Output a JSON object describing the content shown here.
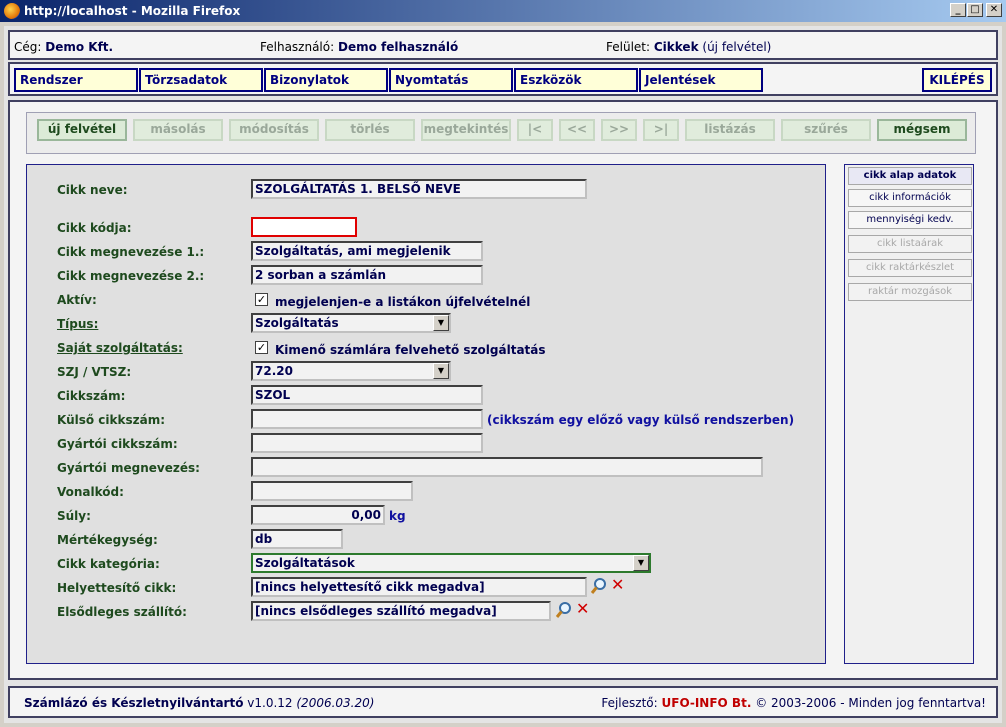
{
  "window": {
    "title": "http://localhost - Mozilla Firefox",
    "min": "_",
    "max": "□",
    "close": "✕"
  },
  "info": {
    "company_label": "Cég:",
    "company": "Demo Kft.",
    "user_label": "Felhasználó:",
    "user": "Demo felhasználó",
    "surface_label": "Felület:",
    "surface": "Cikkek",
    "surface_mode": "(új felvétel)"
  },
  "menu": [
    "Rendszer",
    "Törzsadatok",
    "Bizonylatok",
    "Nyomtatás",
    "Eszközök",
    "Jelentések"
  ],
  "logout": "KILÉPÉS",
  "toolbar": [
    {
      "label": "új felvétel",
      "enabled": true
    },
    {
      "label": "másolás",
      "enabled": false
    },
    {
      "label": "módosítás",
      "enabled": false
    },
    {
      "label": "törlés",
      "enabled": false
    },
    {
      "label": "megtekintés",
      "enabled": false
    },
    {
      "label": "|<",
      "enabled": false
    },
    {
      "label": "<<",
      "enabled": false
    },
    {
      "label": ">>",
      "enabled": false
    },
    {
      "label": ">|",
      "enabled": false
    },
    {
      "label": "listázás",
      "enabled": false
    },
    {
      "label": "szűrés",
      "enabled": false
    },
    {
      "label": "mégsem",
      "enabled": true
    }
  ],
  "side_buttons": [
    {
      "label": "cikk alap adatok",
      "state": "active"
    },
    {
      "label": "cikk információk",
      "state": "enabled"
    },
    {
      "label": "mennyiségi kedv.",
      "state": "enabled"
    },
    {
      "label": "cikk listaárak",
      "state": "disabled"
    },
    {
      "label": "cikk raktárkészlet",
      "state": "disabled"
    },
    {
      "label": "raktár mozgások",
      "state": "disabled"
    }
  ],
  "form": {
    "name_label": "Cikk neve:",
    "name": "SZOLGÁLTATÁS 1. BELSŐ NEVE",
    "code_label": "Cikk kódja:",
    "code": "",
    "desc1_label": "Cikk megnevezése 1.:",
    "desc1": "Szolgáltatás, ami megjelenik",
    "desc2_label": "Cikk megnevezése 2.:",
    "desc2": "2 sorban a számlán",
    "active_label": "Aktív:",
    "active_check": "✓",
    "active_text": "megjelenjen-e a listákon újfelvételnél",
    "type_label": "Típus:",
    "type": "Szolgáltatás",
    "own_service_label": "Saját szolgáltatás:",
    "own_service_check": "✓",
    "own_service_text": "Kimenő számlára felvehető szolgáltatás",
    "szj_label": "SZJ / VTSZ:",
    "szj": "72.20",
    "item_no_label": "Cikkszám:",
    "item_no": "SZOL",
    "ext_item_no_label": "Külső cikkszám:",
    "ext_item_no": "",
    "ext_item_note": "(cikkszám egy előző vagy külső rendszerben)",
    "mfr_item_no_label": "Gyártói cikkszám:",
    "mfr_item_no": "",
    "mfr_name_label": "Gyártói megnevezés:",
    "mfr_name": "",
    "barcode_label": "Vonalkód:",
    "barcode": "",
    "weight_label": "Súly:",
    "weight": "0,00",
    "weight_unit": "kg",
    "unit_label": "Mértékegység:",
    "unit": "db",
    "category_label": "Cikk kategória:",
    "category": "Szolgáltatások",
    "substitute_label": "Helyettesítő cikk:",
    "substitute": "[nincs helyettesítő cikk megadva]",
    "supplier_label": "Elsődleges szállító:",
    "supplier": "[nincs elsődleges szállító megadva]"
  },
  "footer": {
    "app": "Számlázó és Készletnyilvántartó",
    "version": "v1.0.12",
    "date": "(2006.03.20)",
    "dev_label": "Fejlesztő:",
    "dev": "UFO-INFO Bt.",
    "copyright": "© 2003-2006 - Minden jog fenntartva!"
  },
  "colors": {
    "menu_bg": "#ffffd8",
    "menu_border": "#000080",
    "label_green": "#1e4a1e",
    "error_border": "#e00000"
  }
}
